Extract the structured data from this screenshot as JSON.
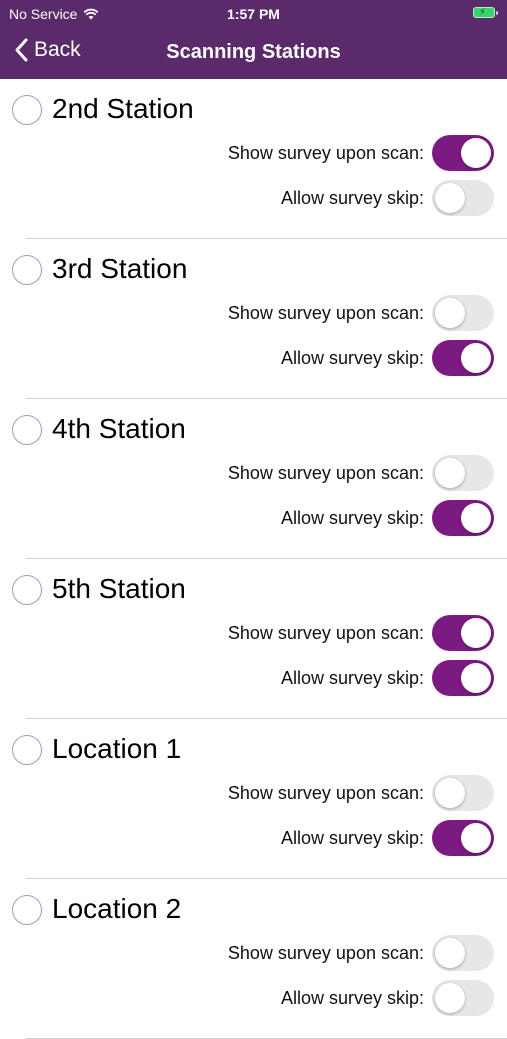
{
  "status_bar": {
    "carrier": "No Service",
    "time": "1:57 PM",
    "wifi_icon": "wifi-icon",
    "battery_icon": "battery-charging-icon"
  },
  "nav": {
    "back_label": "Back",
    "title": "Scanning Stations",
    "back_icon": "chevron-left-icon"
  },
  "labels": {
    "show_survey": "Show survey upon scan:",
    "allow_skip": "Allow survey skip:"
  },
  "stations": [
    {
      "name": "2nd Station",
      "show_survey": true,
      "allow_skip": false
    },
    {
      "name": "3rd Station",
      "show_survey": false,
      "allow_skip": true
    },
    {
      "name": "4th Station",
      "show_survey": false,
      "allow_skip": true
    },
    {
      "name": "5th Station",
      "show_survey": true,
      "allow_skip": true
    },
    {
      "name": "Location 1",
      "show_survey": false,
      "allow_skip": true
    },
    {
      "name": "Location 2",
      "show_survey": false,
      "allow_skip": false
    }
  ],
  "colors": {
    "header": "#5b2a6b",
    "accent": "#7b1b82",
    "toggle_off": "#e7e7e9"
  }
}
